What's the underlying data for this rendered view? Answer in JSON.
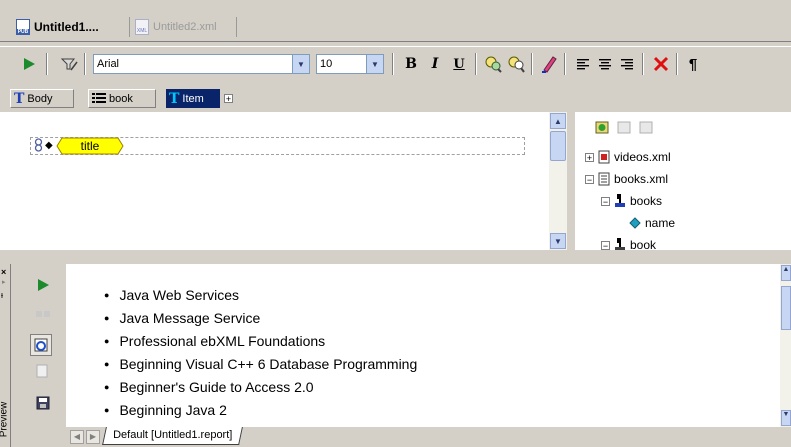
{
  "doc_tabs": [
    {
      "label": "Untitled1....",
      "icon": "pub-file-icon"
    },
    {
      "label": "Untitled2.xml",
      "icon": "xml-file-icon"
    }
  ],
  "toolbar": {
    "font_family": "Arial",
    "font_size": "10",
    "bold_label": "B",
    "italic_label": "I",
    "underline_label": "U"
  },
  "breadcrumb": [
    {
      "label": "Body",
      "icon": "text-T-icon"
    },
    {
      "label": "book",
      "icon": "list-icon"
    },
    {
      "label": "Item",
      "icon": "text-T-icon",
      "selected": true
    }
  ],
  "editor": {
    "field_tag": "title"
  },
  "xml_tree": [
    {
      "label": "videos.xml",
      "icon": "xml-doc-icon",
      "expander": "+"
    },
    {
      "label": "books.xml",
      "icon": "doc-icon",
      "expander": "-"
    },
    {
      "label": "books",
      "icon": "element-icon",
      "expander": "-"
    },
    {
      "label": "name",
      "icon": "attribute-icon",
      "expander": ""
    },
    {
      "label": "book",
      "icon": "element-icon",
      "expander": "-"
    }
  ],
  "preview": {
    "side_label": "Preview",
    "items": [
      "Java Web Services",
      "Java Message Service",
      "Professional ebXML Foundations",
      "Beginning Visual C++ 6 Database Programming",
      "Beginner's Guide to Access 2.0",
      "Beginning Java 2"
    ],
    "sheet_tab": "Default [Untitled1.report]"
  },
  "colors": {
    "accent": "#0a246a",
    "play": "#1e8a2e",
    "delete": "#e01010",
    "tag_fill": "#ffff00"
  }
}
